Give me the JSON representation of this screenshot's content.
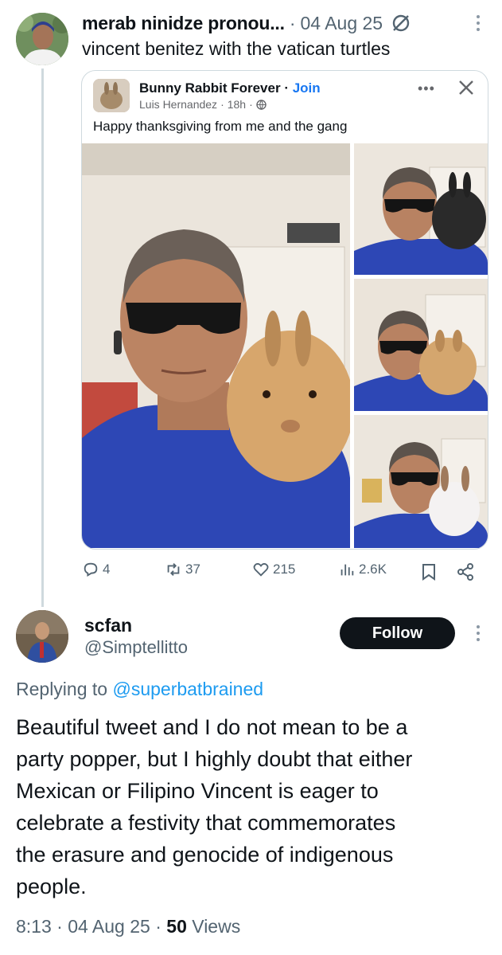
{
  "quoted_tweet": {
    "author": "merab ninidze pronou...",
    "separator": "·",
    "date": "04 Aug 25",
    "status_icon": "grok-slash-circle-icon",
    "more_icon": "more-vertical-icon",
    "text": "vincent benitez with the vatican turtles",
    "embedded_post": {
      "group_name": "Bunny Rabbit Forever",
      "join_label": "Join",
      "join_separator": " · ",
      "poster": "Luis Hernandez",
      "time": "18h",
      "meta_separator": "·",
      "privacy_icon": "globe-icon",
      "more_label": "•••",
      "close_icon": "close-icon",
      "caption": "Happy thanksgiving from me and the gang",
      "photos": [
        "main-photo",
        "photo-2",
        "photo-3",
        "photo-4"
      ]
    },
    "actions": {
      "replies": "4",
      "reposts": "37",
      "likes": "215",
      "views": "2.6K",
      "bookmark_icon": "bookmark-icon",
      "share_icon": "share-icon"
    }
  },
  "reply": {
    "name": "scfan",
    "handle": "@Simptellitto",
    "follow_label": "Follow",
    "replying_prefix": "Replying to",
    "replying_to": "@superbatbrained",
    "body_lines": [
      "Beautiful tweet and I do not mean to be a",
      "party popper, but I highly doubt that either",
      "Mexican or Filipino Vincent is eager to",
      "celebrate a festivity that commemorates",
      "the erasure and genocide of indigenous",
      "people."
    ],
    "time": "8:13",
    "separator": "·",
    "date": "04 Aug 25",
    "views_count": "50",
    "views_label": "Views"
  },
  "colors": {
    "text_primary": "#0f1419",
    "text_secondary": "#536471",
    "link": "#1d9bf0",
    "facebook_blue": "#1877f2",
    "follow_bg": "#0f1419"
  }
}
